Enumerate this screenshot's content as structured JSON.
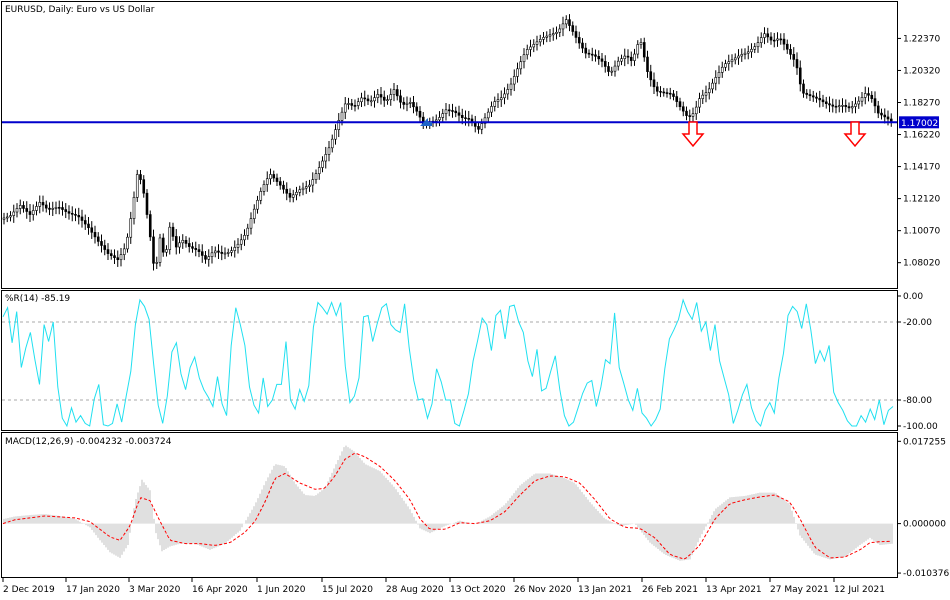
{
  "chart_data": [
    {
      "type": "candlestick",
      "panel": "price",
      "title": "EURUSD, Daily:  Euro vs US Dollar",
      "ylim": [
        1.064,
        1.247
      ],
      "y_ticks": [
        "1.22370",
        "1.20320",
        "1.18270",
        "1.16220",
        "1.14170",
        "1.12120",
        "1.10070",
        "1.08020"
      ],
      "horizontal_line": {
        "value": 1.17002,
        "label": "1.17002",
        "color": "#0000CC"
      },
      "current_price": {
        "label": "1.17002",
        "color": "#0000CC"
      },
      "x_ticks": [
        "2 Dec 2019",
        "17 Jan 2020",
        "3 Mar 2020",
        "16 Apr 2020",
        "1 Jun 2020",
        "15 Jul 2020",
        "28 Aug 2020",
        "13 Oct 2020",
        "26 Nov 2020",
        "13 Jan 2021",
        "26 Feb 2021",
        "13 Apr 2021",
        "27 May 2021",
        "12 Jul 2021"
      ],
      "close_path": [
        [
          0,
          1.108
        ],
        [
          10,
          1.11
        ],
        [
          20,
          1.117
        ],
        [
          30,
          1.111
        ],
        [
          40,
          1.119
        ],
        [
          48,
          1.114
        ],
        [
          58,
          1.116
        ],
        [
          68,
          1.112
        ],
        [
          78,
          1.11
        ],
        [
          88,
          1.103
        ],
        [
          98,
          1.094
        ],
        [
          108,
          1.086
        ],
        [
          118,
          1.082
        ],
        [
          126,
          1.091
        ],
        [
          132,
          1.113
        ],
        [
          138,
          1.14
        ],
        [
          144,
          1.124
        ],
        [
          150,
          1.098
        ],
        [
          155,
          1.072
        ],
        [
          160,
          1.096
        ],
        [
          165,
          1.082
        ],
        [
          170,
          1.104
        ],
        [
          176,
          1.09
        ],
        [
          182,
          1.095
        ],
        [
          190,
          1.09
        ],
        [
          198,
          1.088
        ],
        [
          206,
          1.082
        ],
        [
          214,
          1.088
        ],
        [
          222,
          1.086
        ],
        [
          230,
          1.087
        ],
        [
          238,
          1.092
        ],
        [
          246,
          1.099
        ],
        [
          254,
          1.114
        ],
        [
          262,
          1.128
        ],
        [
          270,
          1.137
        ],
        [
          280,
          1.13
        ],
        [
          290,
          1.122
        ],
        [
          300,
          1.127
        ],
        [
          310,
          1.13
        ],
        [
          320,
          1.142
        ],
        [
          330,
          1.155
        ],
        [
          338,
          1.17
        ],
        [
          346,
          1.183
        ],
        [
          354,
          1.18
        ],
        [
          362,
          1.186
        ],
        [
          370,
          1.183
        ],
        [
          378,
          1.188
        ],
        [
          386,
          1.183
        ],
        [
          394,
          1.191
        ],
        [
          402,
          1.181
        ],
        [
          410,
          1.183
        ],
        [
          418,
          1.176
        ],
        [
          424,
          1.168
        ],
        [
          430,
          1.17
        ],
        [
          438,
          1.172
        ],
        [
          446,
          1.178
        ],
        [
          454,
          1.177
        ],
        [
          462,
          1.173
        ],
        [
          470,
          1.172
        ],
        [
          478,
          1.165
        ],
        [
          486,
          1.174
        ],
        [
          494,
          1.183
        ],
        [
          502,
          1.186
        ],
        [
          510,
          1.193
        ],
        [
          518,
          1.205
        ],
        [
          526,
          1.216
        ],
        [
          534,
          1.22
        ],
        [
          542,
          1.224
        ],
        [
          550,
          1.226
        ],
        [
          558,
          1.228
        ],
        [
          566,
          1.236
        ],
        [
          572,
          1.229
        ],
        [
          578,
          1.222
        ],
        [
          586,
          1.214
        ],
        [
          594,
          1.213
        ],
        [
          602,
          1.209
        ],
        [
          610,
          1.201
        ],
        [
          618,
          1.209
        ],
        [
          626,
          1.213
        ],
        [
          632,
          1.209
        ],
        [
          640,
          1.224
        ],
        [
          648,
          1.201
        ],
        [
          656,
          1.19
        ],
        [
          664,
          1.189
        ],
        [
          672,
          1.188
        ],
        [
          680,
          1.18
        ],
        [
          688,
          1.173
        ],
        [
          694,
          1.176
        ],
        [
          700,
          1.186
        ],
        [
          708,
          1.19
        ],
        [
          716,
          1.199
        ],
        [
          724,
          1.207
        ],
        [
          732,
          1.21
        ],
        [
          740,
          1.213
        ],
        [
          748,
          1.215
        ],
        [
          756,
          1.219
        ],
        [
          764,
          1.227
        ],
        [
          772,
          1.222
        ],
        [
          780,
          1.224
        ],
        [
          788,
          1.216
        ],
        [
          796,
          1.208
        ],
        [
          802,
          1.189
        ],
        [
          810,
          1.187
        ],
        [
          818,
          1.185
        ],
        [
          826,
          1.182
        ],
        [
          834,
          1.18
        ],
        [
          842,
          1.181
        ],
        [
          850,
          1.179
        ],
        [
          858,
          1.183
        ],
        [
          866,
          1.189
        ],
        [
          872,
          1.185
        ],
        [
          878,
          1.176
        ],
        [
          886,
          1.173
        ],
        [
          893,
          1.17
        ]
      ]
    },
    {
      "type": "line",
      "panel": "williams_r",
      "title": "%R(14) -85.19",
      "ylim": [
        -100,
        0
      ],
      "y_ticks": [
        "0.00",
        "-20.00",
        "-80.00",
        "-100.00"
      ],
      "levels": [
        -20,
        -80
      ],
      "color": "#20E0F0",
      "values": [
        -16,
        -9,
        -36,
        -12,
        -55,
        -40,
        -28,
        -49,
        -68,
        -22,
        -35,
        -20,
        -70,
        -94,
        -100,
        -86,
        -97,
        -92,
        -98,
        -100,
        -79,
        -68,
        -99,
        -100,
        -98,
        -83,
        -97,
        -77,
        -58,
        -22,
        -3,
        -8,
        -18,
        -52,
        -84,
        -98,
        -77,
        -43,
        -36,
        -60,
        -72,
        -55,
        -47,
        -63,
        -72,
        -78,
        -85,
        -62,
        -83,
        -92,
        -38,
        -9,
        -22,
        -38,
        -70,
        -84,
        -90,
        -63,
        -85,
        -80,
        -68,
        -68,
        -35,
        -80,
        -87,
        -72,
        -81,
        -69,
        -24,
        -5,
        -9,
        -14,
        -5,
        -15,
        -5,
        -54,
        -82,
        -77,
        -63,
        -16,
        -15,
        -35,
        -21,
        -9,
        -6,
        -22,
        -26,
        -28,
        -6,
        -40,
        -65,
        -80,
        -79,
        -94,
        -83,
        -56,
        -66,
        -80,
        -80,
        -98,
        -100,
        -88,
        -75,
        -50,
        -34,
        -17,
        -22,
        -42,
        -15,
        -11,
        -33,
        -8,
        -7,
        -20,
        -28,
        -50,
        -62,
        -41,
        -73,
        -71,
        -58,
        -46,
        -72,
        -92,
        -100,
        -97,
        -86,
        -75,
        -67,
        -65,
        -85,
        -70,
        -49,
        -52,
        -13,
        -55,
        -67,
        -80,
        -88,
        -71,
        -90,
        -94,
        -100,
        -95,
        -87,
        -56,
        -33,
        -26,
        -18,
        -3,
        -12,
        -18,
        -5,
        -27,
        -20,
        -42,
        -22,
        -50,
        -63,
        -76,
        -98,
        -88,
        -76,
        -68,
        -86,
        -96,
        -100,
        -88,
        -82,
        -90,
        -63,
        -44,
        -15,
        -8,
        -12,
        -25,
        -6,
        -26,
        -52,
        -42,
        -50,
        -38,
        -74,
        -82,
        -88,
        -96,
        -100,
        -100,
        -92,
        -97,
        -87,
        -95,
        -80,
        -99,
        -88,
        -85
      ],
      "values_note": "sampled daily series, drawn left to right across the panel"
    },
    {
      "type": "histogram+line",
      "panel": "macd",
      "title": "MACD(12,26,9) -0.004232 -0.003724",
      "ylim": [
        -0.0112,
        0.019
      ],
      "y_ticks": [
        "0.017255",
        "0.000000",
        "-0.010376"
      ],
      "histogram_color": "#C0C0C0",
      "signal_color": "#FF0000",
      "macd_path": [
        [
          0,
          0.0008
        ],
        [
          15,
          0.0015
        ],
        [
          30,
          0.0018
        ],
        [
          45,
          0.002
        ],
        [
          60,
          0.0016
        ],
        [
          75,
          0.001
        ],
        [
          90,
          -0.0008
        ],
        [
          100,
          -0.0035
        ],
        [
          110,
          -0.006
        ],
        [
          120,
          -0.0072
        ],
        [
          128,
          -0.0045
        ],
        [
          135,
          0.0045
        ],
        [
          142,
          0.0092
        ],
        [
          150,
          0.007
        ],
        [
          156,
          -0.002
        ],
        [
          162,
          -0.0058
        ],
        [
          170,
          -0.0048
        ],
        [
          180,
          -0.0042
        ],
        [
          195,
          -0.0042
        ],
        [
          210,
          -0.0055
        ],
        [
          225,
          -0.0042
        ],
        [
          240,
          -0.0015
        ],
        [
          255,
          0.004
        ],
        [
          265,
          0.0085
        ],
        [
          275,
          0.0125
        ],
        [
          285,
          0.012
        ],
        [
          295,
          0.0085
        ],
        [
          305,
          0.006
        ],
        [
          315,
          0.0058
        ],
        [
          325,
          0.0075
        ],
        [
          335,
          0.012
        ],
        [
          345,
          0.0165
        ],
        [
          355,
          0.015
        ],
        [
          365,
          0.0125
        ],
        [
          380,
          0.011
        ],
        [
          395,
          0.0075
        ],
        [
          410,
          0.003
        ],
        [
          420,
          -0.001
        ],
        [
          430,
          -0.002
        ],
        [
          445,
          -0.0005
        ],
        [
          460,
          0.0006
        ],
        [
          475,
          -0.0002
        ],
        [
          490,
          0.0015
        ],
        [
          505,
          0.004
        ],
        [
          520,
          0.008
        ],
        [
          535,
          0.0105
        ],
        [
          550,
          0.0105
        ],
        [
          565,
          0.0095
        ],
        [
          575,
          0.0085
        ],
        [
          590,
          0.0045
        ],
        [
          605,
          0.001
        ],
        [
          620,
          -0.0005
        ],
        [
          635,
          0.0
        ],
        [
          650,
          -0.004
        ],
        [
          665,
          -0.0065
        ],
        [
          680,
          -0.0078
        ],
        [
          690,
          -0.0075
        ],
        [
          700,
          -0.003
        ],
        [
          715,
          0.003
        ],
        [
          730,
          0.0055
        ],
        [
          745,
          0.0058
        ],
        [
          760,
          0.0065
        ],
        [
          775,
          0.0065
        ],
        [
          790,
          0.004
        ],
        [
          800,
          -0.0025
        ],
        [
          815,
          -0.0065
        ],
        [
          830,
          -0.0075
        ],
        [
          845,
          -0.007
        ],
        [
          860,
          -0.0045
        ],
        [
          870,
          -0.003
        ],
        [
          880,
          -0.0045
        ],
        [
          893,
          -0.0042
        ]
      ],
      "signal_path": [
        [
          0,
          -0.0002
        ],
        [
          15,
          0.0008
        ],
        [
          30,
          0.0012
        ],
        [
          45,
          0.0016
        ],
        [
          60,
          0.0014
        ],
        [
          75,
          0.0012
        ],
        [
          90,
          0.0004
        ],
        [
          100,
          -0.0012
        ],
        [
          110,
          -0.0028
        ],
        [
          120,
          -0.0035
        ],
        [
          130,
          -0.0005
        ],
        [
          140,
          0.0055
        ],
        [
          150,
          0.0048
        ],
        [
          160,
          0.0005
        ],
        [
          170,
          -0.0035
        ],
        [
          185,
          -0.0042
        ],
        [
          200,
          -0.0042
        ],
        [
          215,
          -0.0046
        ],
        [
          230,
          -0.004
        ],
        [
          245,
          -0.0018
        ],
        [
          255,
          0.0005
        ],
        [
          265,
          0.0045
        ],
        [
          275,
          0.0095
        ],
        [
          285,
          0.0105
        ],
        [
          300,
          0.0085
        ],
        [
          315,
          0.0072
        ],
        [
          325,
          0.0074
        ],
        [
          335,
          0.01
        ],
        [
          345,
          0.0135
        ],
        [
          355,
          0.0148
        ],
        [
          365,
          0.014
        ],
        [
          380,
          0.012
        ],
        [
          395,
          0.009
        ],
        [
          410,
          0.005
        ],
        [
          420,
          0.001
        ],
        [
          430,
          -0.0012
        ],
        [
          445,
          -0.0012
        ],
        [
          460,
          0.0002
        ],
        [
          475,
          0.0
        ],
        [
          490,
          0.0006
        ],
        [
          505,
          0.0025
        ],
        [
          520,
          0.006
        ],
        [
          535,
          0.009
        ],
        [
          550,
          0.01
        ],
        [
          565,
          0.0098
        ],
        [
          580,
          0.0085
        ],
        [
          595,
          0.005
        ],
        [
          610,
          0.001
        ],
        [
          625,
          -0.0008
        ],
        [
          640,
          -0.001
        ],
        [
          655,
          -0.003
        ],
        [
          670,
          -0.0065
        ],
        [
          685,
          -0.0075
        ],
        [
          700,
          -0.0045
        ],
        [
          715,
          0.001
        ],
        [
          730,
          0.0042
        ],
        [
          745,
          0.005
        ],
        [
          760,
          0.0056
        ],
        [
          775,
          0.006
        ],
        [
          790,
          0.0045
        ],
        [
          800,
          0.001
        ],
        [
          815,
          -0.005
        ],
        [
          830,
          -0.0072
        ],
        [
          845,
          -0.007
        ],
        [
          860,
          -0.0055
        ],
        [
          870,
          -0.004
        ],
        [
          880,
          -0.0038
        ],
        [
          893,
          -0.0037
        ]
      ]
    }
  ],
  "annotations": {
    "down_arrows": [
      {
        "near": "26 Feb 2021",
        "color": "#FF0000",
        "icon": "down-arrow-icon"
      },
      {
        "near": "12 Jul 2021",
        "color": "#FF0000",
        "icon": "down-arrow-icon"
      }
    ],
    "trade_marker": {
      "near": "28 Aug 2020",
      "icon": "buy-arrow-icon",
      "color": "#1E64C8"
    }
  },
  "colors": {
    "background": "#FFFFFF",
    "candles": "#000000",
    "axis_line": "#000000",
    "grid_level": "#AAAAAA",
    "price_line": "#0000CC",
    "price_label_bg": "#0000CC",
    "price_label_text": "#FFFFFF"
  }
}
